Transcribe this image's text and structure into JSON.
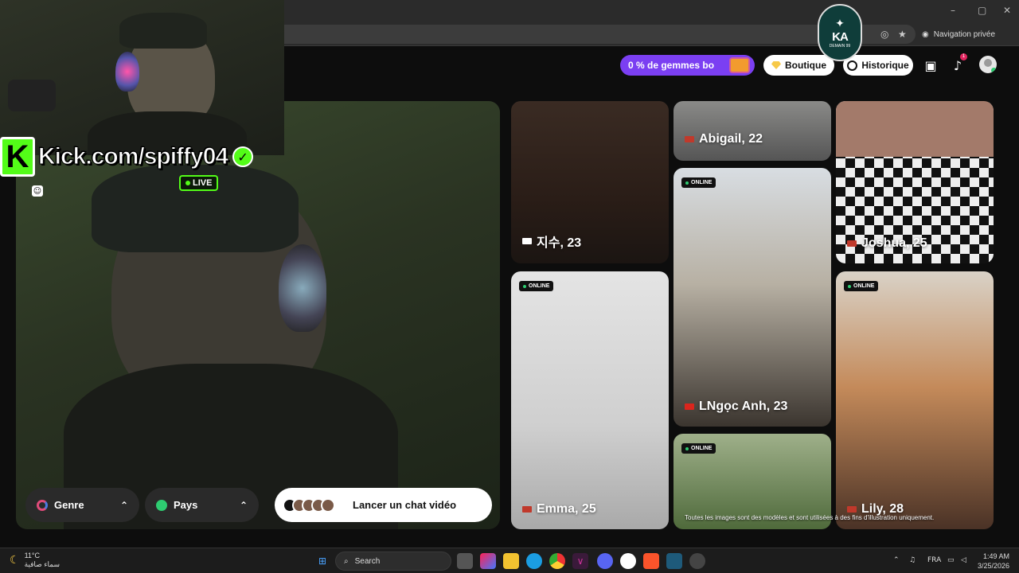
{
  "browser": {
    "private_label": "Navigation privée",
    "window_controls": [
      "–",
      "▢",
      "✕"
    ]
  },
  "header": {
    "gems_label": "0 % de gemmes bo",
    "shop_label": "Boutique",
    "history_label": "Historique",
    "notification_count": "1",
    "logo_text": "KA",
    "logo_sub": "DEMAIN 99"
  },
  "stream_overlay": {
    "kick_letter": "K",
    "kick_url": "Kick.com/spiffy04",
    "live_label": "LIVE"
  },
  "controls": {
    "genre_label": "Genre",
    "country_label": "Pays",
    "launch_label": "Lancer un chat vidéo"
  },
  "profiles": [
    {
      "name": "지수, 23",
      "online": false
    },
    {
      "name": "Abigail, 22",
      "online": false
    },
    {
      "name": "Joshua, 25",
      "online": false
    },
    {
      "name": "LNgọc Anh, 23",
      "online": true
    },
    {
      "name": "Emma, 25",
      "online": true
    },
    {
      "name": "Lily, 28",
      "online": true
    },
    {
      "name": "",
      "online": true
    }
  ],
  "online_label": "ONLINE",
  "disclaimer": "Toutes les images sont des modèles et sont utilisées à des fins d'illustration uniquement.",
  "taskbar": {
    "temperature": "11°C",
    "weather_text": "سماء صافية",
    "search_label": "Search",
    "language": "FRA",
    "time": "1:49 AM",
    "date": "3/25/2026"
  },
  "colors": {
    "accent_purple": "#7b3ff2",
    "kick_green": "#53fc18",
    "online_green": "#2ecc71"
  }
}
